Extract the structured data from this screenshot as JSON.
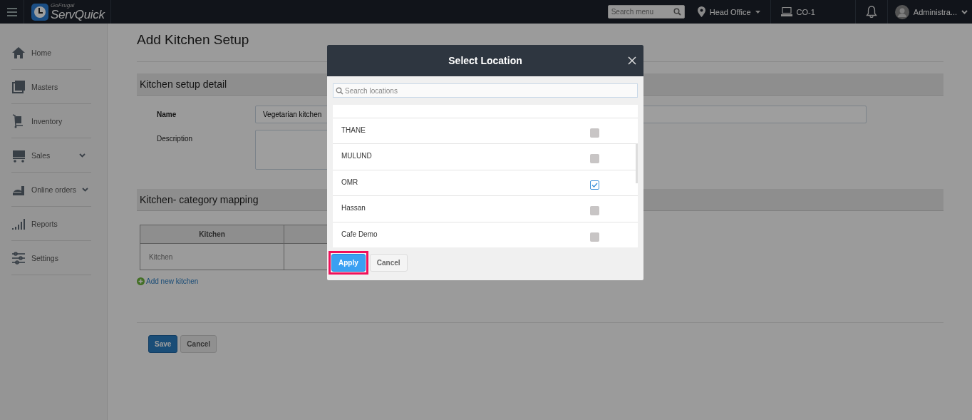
{
  "topbar": {
    "brand_small": "GoFrugal",
    "brand": "ServQuick",
    "search": {
      "placeholder": "Search menu"
    },
    "location": "Head Office",
    "counter": "CO-1",
    "user": "Administra..."
  },
  "sidebar": {
    "items": [
      {
        "label": "Home",
        "expandable": false
      },
      {
        "label": "Masters",
        "expandable": false
      },
      {
        "label": "Inventory",
        "expandable": false
      },
      {
        "label": "Sales",
        "expandable": true
      },
      {
        "label": "Online orders",
        "expandable": true
      },
      {
        "label": "Reports",
        "expandable": false
      },
      {
        "label": "Settings",
        "expandable": false
      }
    ]
  },
  "page": {
    "title": "Add Kitchen Setup",
    "detail_heading": "Kitchen setup detail",
    "name_label": "Name",
    "name_value": "Vegetarian kitchen",
    "description_label": "Description",
    "mapping_heading": "Kitchen- category mapping",
    "table": {
      "columns": [
        "Kitchen"
      ],
      "rows": [
        [
          "Kitchen"
        ]
      ]
    },
    "add_link": "Add new kitchen",
    "buttons": [
      {
        "label": "Save",
        "kind": "primary"
      },
      {
        "label": "Cancel",
        "kind": "secondary"
      }
    ]
  },
  "dialog": {
    "title": "Select Location",
    "search": {
      "placeholder": "Search locations"
    },
    "locations": [
      {
        "name": "THANE",
        "checked": false
      },
      {
        "name": "MULUND",
        "checked": false
      },
      {
        "name": "OMR",
        "checked": true
      },
      {
        "name": "Hassan",
        "checked": false
      },
      {
        "name": "Cafe Demo",
        "checked": false
      }
    ],
    "buttons": [
      {
        "label": "Apply",
        "kind": "primary",
        "highlighted": true
      },
      {
        "label": "Cancel",
        "kind": "secondary",
        "highlighted": false
      }
    ]
  }
}
